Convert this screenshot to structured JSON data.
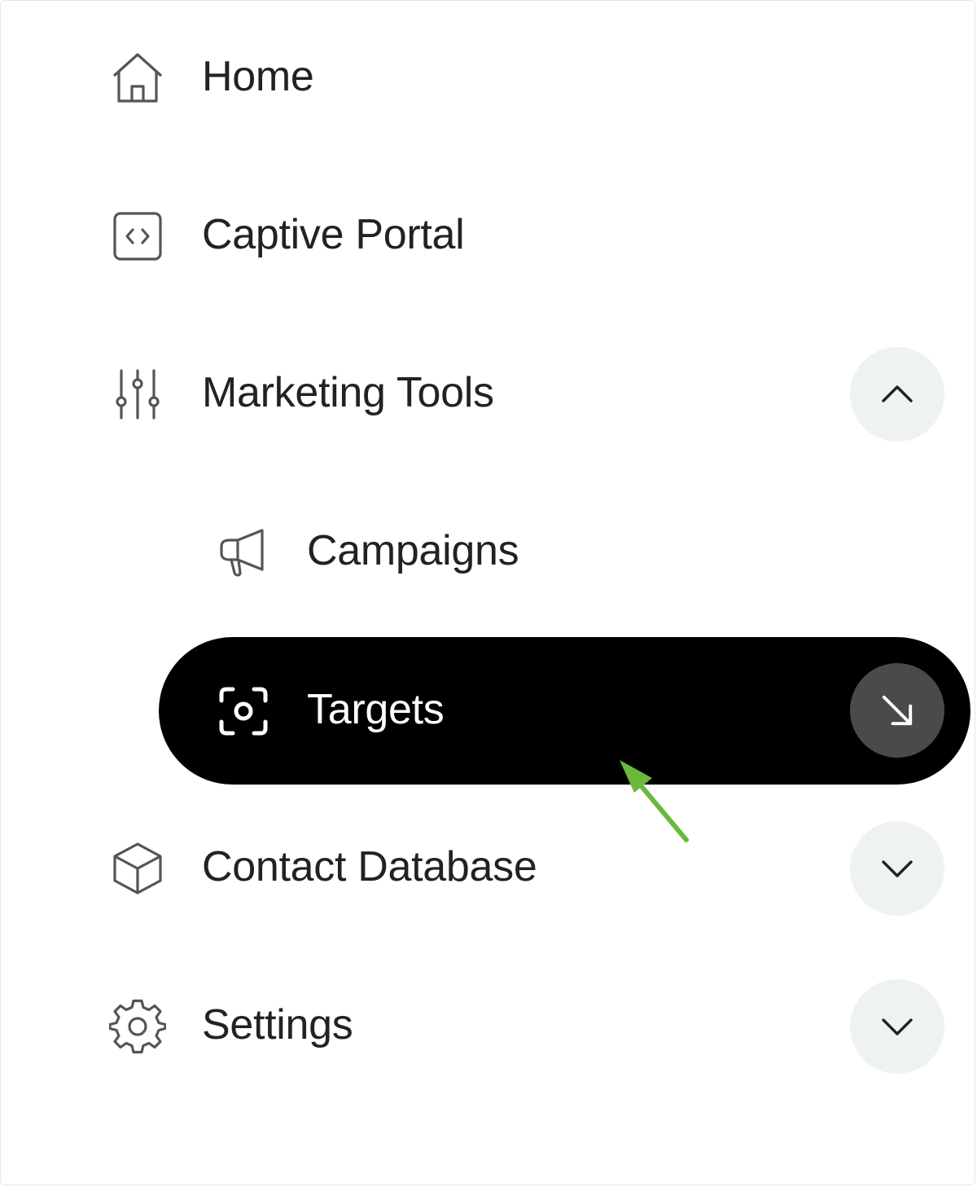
{
  "nav": {
    "home": {
      "label": "Home",
      "icon": "home-icon"
    },
    "captive_portal": {
      "label": "Captive Portal",
      "icon": "code-box-icon"
    },
    "marketing_tools": {
      "label": "Marketing Tools",
      "icon": "sliders-icon",
      "expanded": true,
      "toggle_icon": "chevron-up-icon",
      "children": [
        {
          "label": "Campaigns",
          "icon": "megaphone-icon",
          "active": false
        },
        {
          "label": "Targets",
          "icon": "focus-target-icon",
          "active": true,
          "action_icon": "arrow-down-right-icon"
        }
      ]
    },
    "contact_database": {
      "label": "Contact Database",
      "icon": "cube-icon",
      "expanded": false,
      "toggle_icon": "chevron-down-icon"
    },
    "settings": {
      "label": "Settings",
      "icon": "gear-icon",
      "expanded": false,
      "toggle_icon": "chevron-down-icon"
    }
  },
  "colors": {
    "active_bg": "#000000",
    "active_text": "#ffffff",
    "toggle_bg": "#eff2f3",
    "annotation_arrow": "#6ab93a"
  }
}
